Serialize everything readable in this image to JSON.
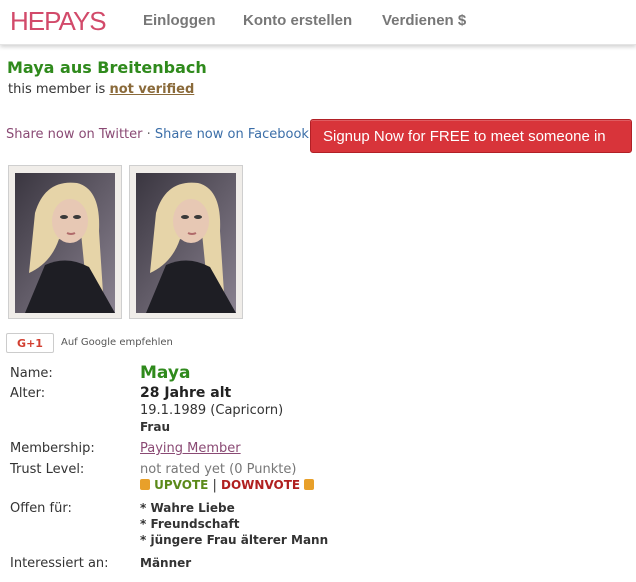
{
  "header": {
    "logo_he": "HE",
    "logo_pays": "PAYS",
    "nav": [
      "Einloggen",
      "Konto erstellen",
      "Verdienen $"
    ]
  },
  "profile": {
    "title": "Maya aus Breitenbach",
    "verif_prefix": "this member is",
    "verif_status": "not verified"
  },
  "share": {
    "twitter": "Share now on Twitter",
    "sep": "·",
    "facebook": "Share now on Facebook",
    "signup": "Signup Now for FREE to meet someone in"
  },
  "google": {
    "button": "G+1",
    "text": "Auf Google empfehlen"
  },
  "details": {
    "name_label": "Name:",
    "name": "Maya",
    "age_label": "Alter:",
    "age": "28 Jahre alt",
    "birth": "19.1.1989 (Capricorn)",
    "gender": "Frau",
    "membership_label": "Membership:",
    "membership": "Paying Member",
    "trust_label": "Trust Level:",
    "trust": "not rated yet (0 Punkte)",
    "upvote": "UPVOTE",
    "vote_sep": "|",
    "downvote": "DOWNVOTE",
    "open_label": "Offen für:",
    "open": [
      "* Wahre Liebe",
      "* Freundschaft",
      "* jüngere Frau älterer Mann"
    ],
    "interest_label": "Interessiert an:",
    "interest": "Männer"
  }
}
